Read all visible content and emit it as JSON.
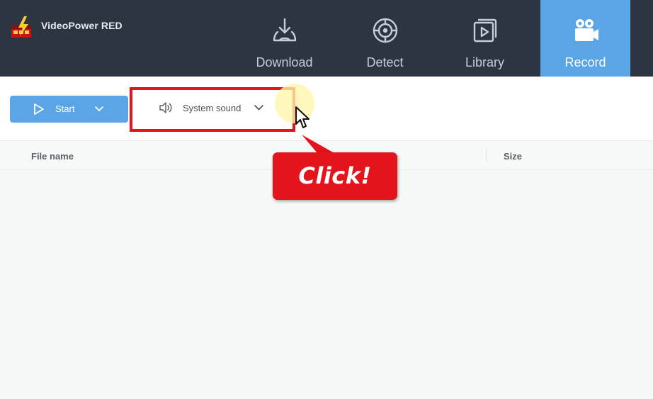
{
  "app": {
    "name": "VideoPower RED"
  },
  "nav": {
    "tabs": [
      {
        "label": "Download",
        "icon": "download-icon"
      },
      {
        "label": "Detect",
        "icon": "detect-target-icon"
      },
      {
        "label": "Library",
        "icon": "library-video-icon"
      },
      {
        "label": "Record",
        "icon": "record-camera-icon",
        "active": true
      }
    ]
  },
  "toolbar": {
    "start_label": "Start",
    "sound_label": "System sound"
  },
  "table": {
    "columns": [
      "File name",
      "Size"
    ],
    "rows": []
  },
  "annotation": {
    "callout_text": "Click!",
    "highlight_color": "#e3141b"
  },
  "colors": {
    "topbar": "#2d3442",
    "accent": "#5aa5e6",
    "callout": "#e3141b"
  }
}
